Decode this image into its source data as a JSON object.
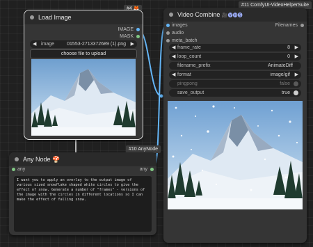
{
  "load_image_node": {
    "badge": "#4",
    "badge_icon": "🦊",
    "title": "Load Image",
    "outputs": [
      "IMAGE",
      "MASK"
    ],
    "image_widget": {
      "name": "image",
      "value": "01553-2713372689 (1).png"
    },
    "upload_button": "choose file to upload",
    "colors": {
      "image_port": "#64b5f6",
      "mask_port": "#81c784"
    }
  },
  "any_node": {
    "badge": "#10 AnyNode",
    "title": "Any Node",
    "title_icon": "🍄",
    "input_label": "any",
    "output_label": "any",
    "prompt": "I want you to apply an overlay to the output image of various sized snowflake shaped white circles to give the effect of snow. Generate a number of \"frames\" - versions of the image with the circles in different locations so I can make the effect of falling snow."
  },
  "video_combine_node": {
    "badge": "#11 ComfyUI-VideoHelperSuite",
    "title": "Video Combine",
    "title_icon": "🎥🅥🅗🅢",
    "inputs": [
      "images",
      "audio",
      "meta_batch"
    ],
    "output_label": "Filenames",
    "widgets": {
      "frame_rate": {
        "name": "frame_rate",
        "value": "8"
      },
      "loop_count": {
        "name": "loop_count",
        "value": "0"
      },
      "filename_prefix": {
        "name": "filename_prefix",
        "value": "AnimateDiff"
      },
      "format": {
        "name": "format",
        "value": "image/gif"
      },
      "pingpong": {
        "name": "pingpong",
        "value": "false"
      },
      "save_output": {
        "name": "save_output",
        "value": "true"
      }
    }
  },
  "colors": {
    "canvas": "#202020",
    "node_body": "#353535",
    "node_title": "#2a2a2a",
    "wire_image": "#64b5f6"
  }
}
